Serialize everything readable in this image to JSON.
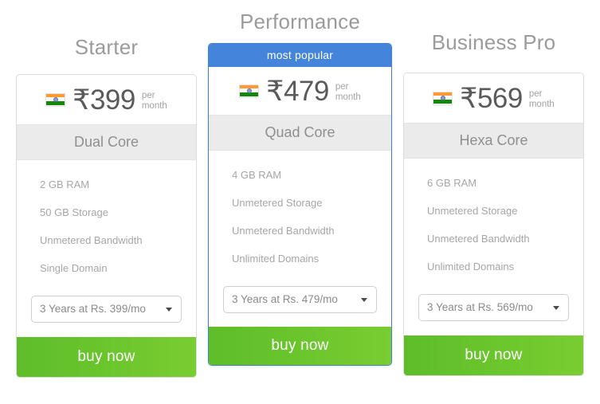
{
  "colors": {
    "accent_blue": "#4484da",
    "buy_green_left": "#5fbd2b",
    "buy_green_right": "#79cd31",
    "band_gray": "#ebebeb",
    "flag_saffron": "#ff9933",
    "flag_green": "#138808",
    "flag_chakra": "#5b6fb5"
  },
  "plans": [
    {
      "title": "Starter",
      "ribbon": null,
      "flag_icon": "india-flag-icon",
      "currency_symbol": "₹",
      "price": "399",
      "price_display": "₹399",
      "per_line1": "per",
      "per_line2": "month",
      "core": "Dual Core",
      "features": [
        "2 GB RAM",
        "50 GB Storage",
        "Unmetered Bandwidth",
        "Single Domain"
      ],
      "term_selected": "3 Years at Rs. 399/mo",
      "term_options": [
        "3 Years at Rs. 399/mo"
      ],
      "buy_label": "buy now"
    },
    {
      "title": "Performance",
      "ribbon": "most popular",
      "flag_icon": "india-flag-icon",
      "currency_symbol": "₹",
      "price": "479",
      "price_display": "₹479",
      "per_line1": "per",
      "per_line2": "month",
      "core": "Quad Core",
      "features": [
        "4 GB RAM",
        "Unmetered Storage",
        "Unmetered Bandwidth",
        "Unlimited Domains"
      ],
      "term_selected": "3 Years at Rs. 479/mo",
      "term_options": [
        "3 Years at Rs. 479/mo"
      ],
      "buy_label": "buy now"
    },
    {
      "title": "Business Pro",
      "ribbon": null,
      "flag_icon": "india-flag-icon",
      "currency_symbol": "₹",
      "price": "569",
      "price_display": "₹569",
      "per_line1": "per",
      "per_line2": "month",
      "core": "Hexa Core",
      "features": [
        "6 GB RAM",
        "Unmetered Storage",
        "Unmetered Bandwidth",
        "Unlimited Domains"
      ],
      "term_selected": "3 Years at Rs. 569/mo",
      "term_options": [
        "3 Years at Rs. 569/mo"
      ],
      "buy_label": "buy now"
    }
  ]
}
